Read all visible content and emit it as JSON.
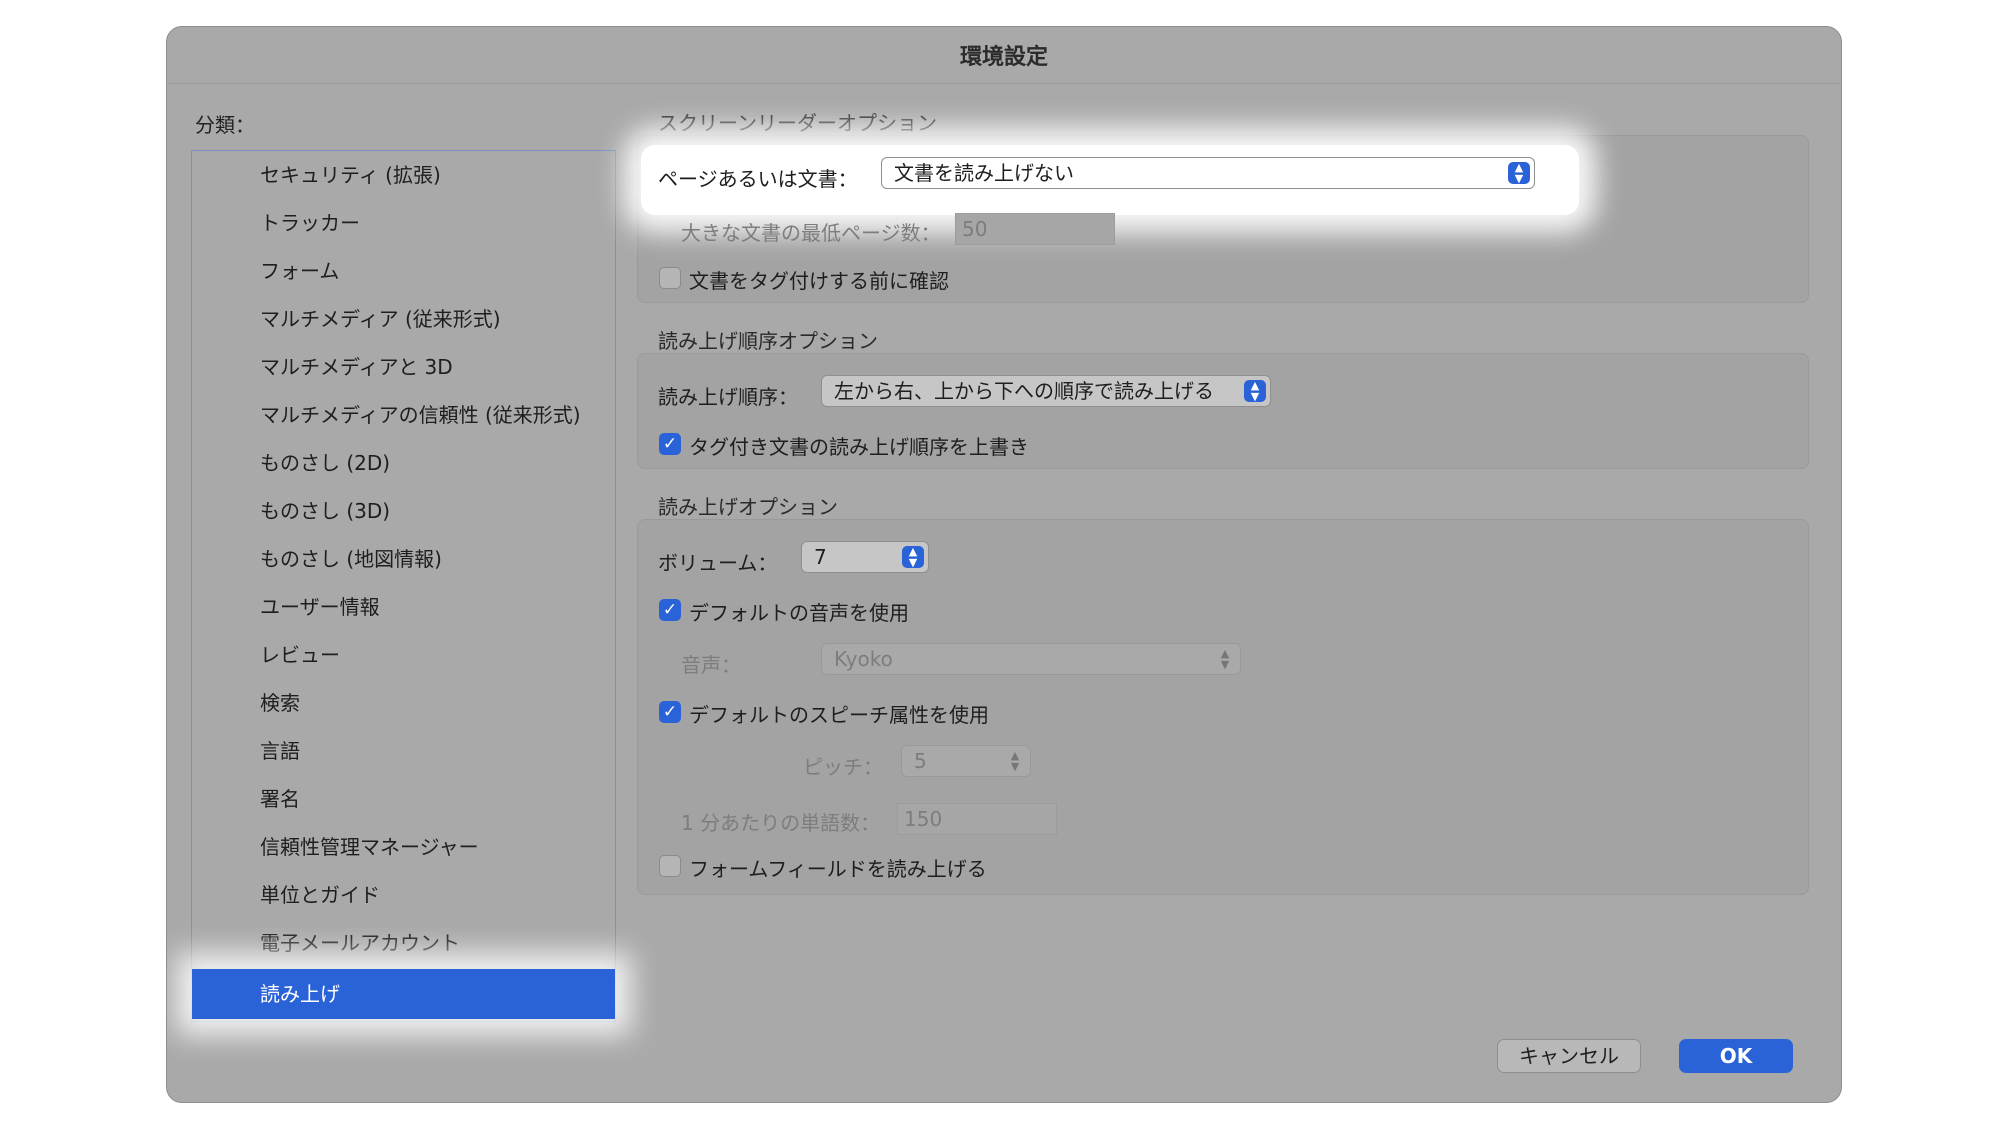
{
  "window": {
    "title": "環境設定"
  },
  "sidebar": {
    "label": "分類：",
    "items": [
      "セキュリティ (拡張)",
      "トラッカー",
      "フォーム",
      "マルチメディア (従来形式)",
      "マルチメディアと 3D",
      "マルチメディアの信頼性 (従来形式)",
      "ものさし (2D)",
      "ものさし (3D)",
      "ものさし (地図情報)",
      "ユーザー情報",
      "レビュー",
      "検索",
      "言語",
      "署名",
      "信頼性管理マネージャー",
      "単位とガイド",
      "電子メールアカウント",
      "読み上げ"
    ],
    "selected": "読み上げ"
  },
  "screen_reader": {
    "title": "スクリーンリーダーオプション",
    "page_label": "ページあるいは文書：",
    "page_value": "文書を読み上げない",
    "min_pages_label": "大きな文書の最低ページ数：",
    "min_pages_value": "50",
    "confirm_tag_label": "文書をタグ付けする前に確認",
    "confirm_tag_checked": false
  },
  "reading_order": {
    "title": "読み上げ順序オプション",
    "order_label": "読み上げ順序：",
    "order_value": "左から右、上から下への順序で読み上げる",
    "override_label": "タグ付き文書の読み上げ順序を上書き",
    "override_checked": true
  },
  "reading": {
    "title": "読み上げオプション",
    "volume_label": "ボリューム：",
    "volume_value": "7",
    "default_voice_label": "デフォルトの音声を使用",
    "default_voice_checked": true,
    "voice_label": "音声：",
    "voice_value": "Kyoko",
    "default_speech_label": "デフォルトのスピーチ属性を使用",
    "default_speech_checked": true,
    "pitch_label": "ピッチ：",
    "pitch_value": "5",
    "wpm_label": "1 分あたりの単語数：",
    "wpm_value": "150",
    "form_fields_label": "フォームフィールドを読み上げる",
    "form_fields_checked": false
  },
  "buttons": {
    "cancel": "キャンセル",
    "ok": "OK"
  },
  "colors": {
    "accent": "#2a62d8",
    "window_bg": "#a9a9a9"
  }
}
